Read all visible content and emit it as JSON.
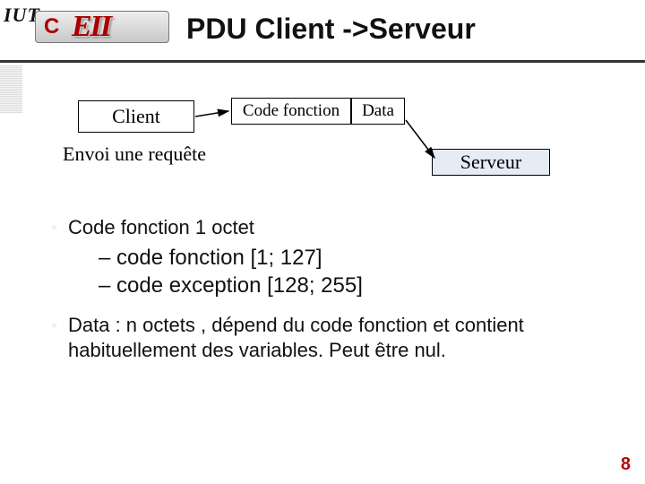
{
  "header": {
    "logo_abbr": "IUT",
    "logo_text": "EII",
    "title": "PDU Client ->Serveur"
  },
  "diagram": {
    "client_label": "Client",
    "code_label": "Code fonction",
    "data_label": "Data",
    "envoi_label": "Envoi une requête",
    "serveur_label": "Serveur"
  },
  "bullets": {
    "b1": "Code fonction 1 octet",
    "sub1": "– code fonction [1; 127]",
    "sub2": "– code exception [128; 255]",
    "b2": "Data : n octets , dépend du code fonction et contient habituellement des variables. Peut être nul."
  },
  "page_number": "8"
}
